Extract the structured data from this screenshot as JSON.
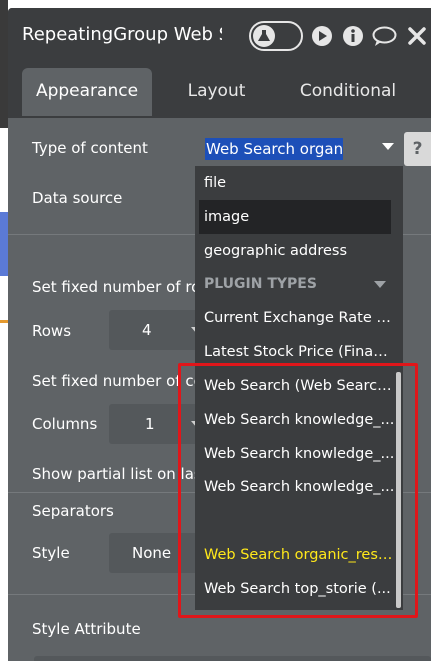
{
  "title": "RepeatingGroup Web Se",
  "tabs": [
    "Appearance",
    "Layout",
    "Conditional"
  ],
  "type_of_content": {
    "label": "Type of content",
    "selected": "Web Search organic",
    "help": "?"
  },
  "labels": {
    "data_source": "Data source",
    "fixed_rows": "Set fixed number of row",
    "rows": "Rows",
    "fixed_cols": "Set fixed number of col",
    "columns": "Columns",
    "partial": "Show partial list on las",
    "separators": "Separators",
    "style": "Style",
    "style_attribute": "Style Attribute"
  },
  "values": {
    "rows": "4",
    "columns": "1",
    "style": "None"
  },
  "menu": {
    "items_top": [
      "file",
      "image",
      "geographic address"
    ],
    "plugin_header": "PLUGIN TYPES",
    "plugin_items": [
      "Current Exchange Rate (F...",
      "Latest Stock Price (Financ...",
      "Web Search (Web Search...",
      "Web Search knowledge_...",
      "Web Search knowledge_...",
      "Web Search knowledge_...",
      "Web Search organic_resu...",
      "Web Search top_storie (..."
    ]
  },
  "colors": {
    "panel": "#5f6366",
    "titlebar": "#3b3d3f",
    "menu": "#3b3d3f",
    "highlight": "#ffe81a",
    "annotation": "#e0161a",
    "selection": "#1d4fb8"
  }
}
